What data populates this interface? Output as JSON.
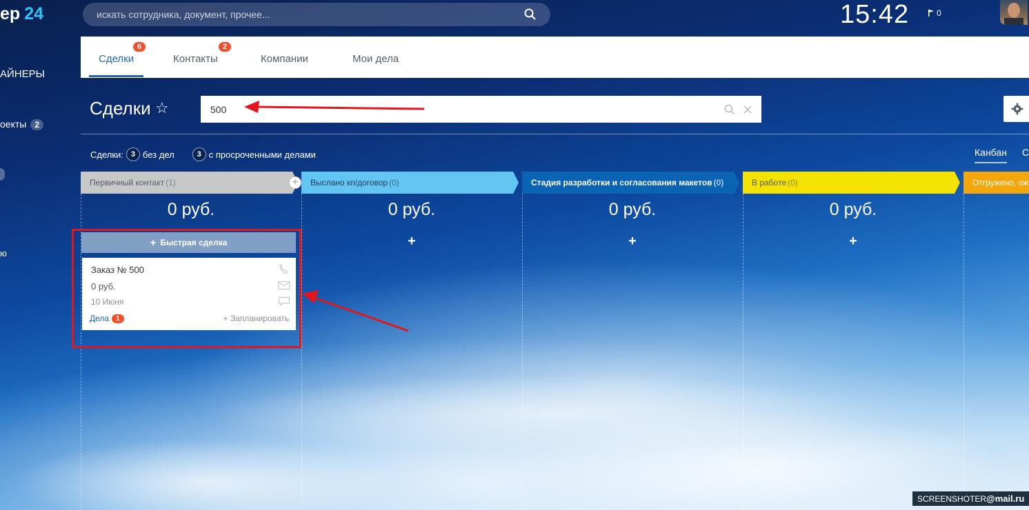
{
  "app": {
    "logo_text": "ер",
    "logo_num": "24"
  },
  "topbar": {
    "search_placeholder": "искать сотрудника, документ, прочее...",
    "clock": "15:42",
    "flag_count": "0"
  },
  "sidebar": {
    "items": [
      {
        "label": "АЙНЕРЫ"
      },
      {
        "label": "оекты",
        "badge": "2"
      },
      {
        "label": "ю"
      }
    ]
  },
  "tabs": [
    {
      "label": "Сделки",
      "badge": "6",
      "active": true
    },
    {
      "label": "Контакты",
      "badge": "2"
    },
    {
      "label": "Компании"
    },
    {
      "label": "Мои дела"
    }
  ],
  "page": {
    "title": "Сделки",
    "filter_value": "500"
  },
  "counters": {
    "prefix": "Сделки:",
    "no_deals_count": "3",
    "no_deals_label": "без дел",
    "overdue_count": "3",
    "overdue_label": "с просроченными делами"
  },
  "view": {
    "kanban": "Канбан",
    "next": "Сп"
  },
  "columns": [
    {
      "title": "Первичный контакт",
      "count": "(1)",
      "sum": "0 руб.",
      "color": "#c8c8c8",
      "text_color": "#535c69"
    },
    {
      "title": "Выслано кп/договор",
      "count": "(0)",
      "sum": "0 руб.",
      "color": "#63c5f1",
      "text_color": "#1f3b57"
    },
    {
      "title": "Стадия разработки и согласования макетов",
      "count": "(0)",
      "sum": "0 руб.",
      "color": "#0b63b4",
      "text_color": "#ffffff"
    },
    {
      "title": "В работе",
      "count": "(0)",
      "sum": "0 руб.",
      "color": "#f4e300",
      "text_color": "#535c69"
    },
    {
      "title": "Отгружено, ож",
      "count": "",
      "sum": "",
      "color": "#f4a60d",
      "text_color": "#ffffff"
    }
  ],
  "quick_deal": "Быстрая сделка",
  "plus": "+",
  "card": {
    "title": "Заказ № 500",
    "sum": "0 руб.",
    "date": "10 Июня",
    "deals_label": "Дела",
    "deals_badge": "1",
    "plan": "+ Запланировать"
  },
  "watermark": {
    "left": "SCREENSHOTER",
    "right": "@mail.ru"
  }
}
